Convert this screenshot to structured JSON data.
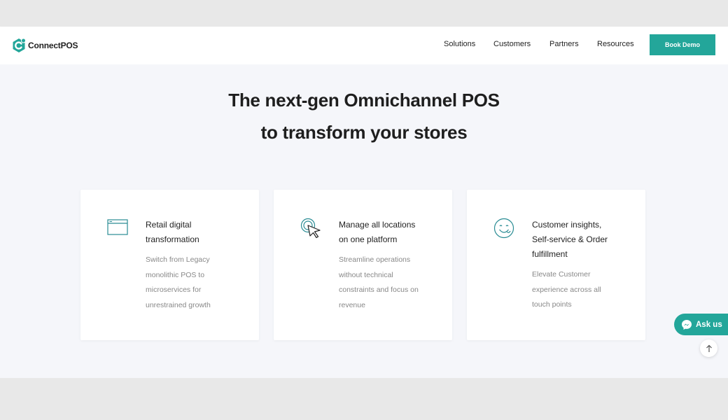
{
  "header": {
    "logo_text": "ConnectPOS",
    "nav": [
      "Solutions",
      "Customers",
      "Partners",
      "Resources"
    ],
    "cta": "Book Demo"
  },
  "hero": {
    "title_line1": "The next-gen Omnichannel POS",
    "title_line2": "to transform your stores"
  },
  "cards": [
    {
      "icon": "browser-window-icon",
      "title": [
        "Retail digital",
        "transformation"
      ],
      "desc": [
        "Switch from Legacy",
        "monolithic POS to",
        "microservices for",
        "unrestrained growth"
      ]
    },
    {
      "icon": "pointer-click-icon",
      "title": [
        "Manage all locations",
        "on one platform"
      ],
      "desc": [
        "Streamline operations",
        "without technical",
        "constraints and focus on",
        "revenue"
      ]
    },
    {
      "icon": "smiley-face-icon",
      "title": [
        "Customer insights,",
        "Self-service & Order",
        "fulfillment"
      ],
      "desc": [
        "Elevate Customer",
        "experience across all",
        "touch points"
      ]
    }
  ],
  "chat": {
    "label": "Ask us"
  },
  "colors": {
    "accent": "#23a69a",
    "hero_bg": "#f5f6fa"
  }
}
